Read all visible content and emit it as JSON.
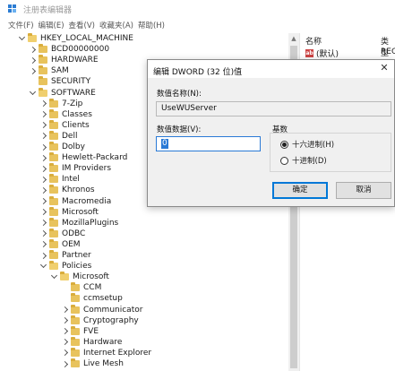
{
  "window": {
    "title": "注册表编辑器"
  },
  "menu": [
    "文件(F)",
    "编辑(E)",
    "查看(V)",
    "收藏夹(A)",
    "帮助(H)"
  ],
  "tree": [
    {
      "label": "HKEY_LOCAL_MACHINE",
      "expanded": true
    },
    {
      "label": "BCD00000000",
      "expanded": false
    },
    {
      "label": "HARDWARE",
      "expanded": false
    },
    {
      "label": "SAM",
      "expanded": false
    },
    {
      "label": "SECURITY",
      "expanded": null
    },
    {
      "label": "SOFTWARE",
      "expanded": true
    },
    {
      "label": "7-Zip",
      "expanded": false
    },
    {
      "label": "Classes",
      "expanded": false
    },
    {
      "label": "Clients",
      "expanded": false
    },
    {
      "label": "Dell",
      "expanded": false
    },
    {
      "label": "Dolby",
      "expanded": false
    },
    {
      "label": "Hewlett-Packard",
      "expanded": false
    },
    {
      "label": "IM Providers",
      "expanded": false
    },
    {
      "label": "Intel",
      "expanded": false
    },
    {
      "label": "Khronos",
      "expanded": false
    },
    {
      "label": "Macromedia",
      "expanded": false
    },
    {
      "label": "Microsoft",
      "expanded": false
    },
    {
      "label": "MozillaPlugins",
      "expanded": false
    },
    {
      "label": "ODBC",
      "expanded": false
    },
    {
      "label": "OEM",
      "expanded": false
    },
    {
      "label": "Partner",
      "expanded": false
    },
    {
      "label": "Policies",
      "expanded": true
    },
    {
      "label": "Microsoft",
      "expanded": true
    },
    {
      "label": "CCM",
      "expanded": null
    },
    {
      "label": "ccmsetup",
      "expanded": null
    },
    {
      "label": "Communicator",
      "expanded": false
    },
    {
      "label": "Cryptography",
      "expanded": false
    },
    {
      "label": "FVE",
      "expanded": false
    },
    {
      "label": "Hardware",
      "expanded": false
    },
    {
      "label": "Internet Explorer",
      "expanded": false
    },
    {
      "label": "Live Mesh",
      "expanded": false
    }
  ],
  "list": {
    "col_name": "名称",
    "col_type": "类型",
    "rows": [
      {
        "name": "(默认)",
        "type": "REG"
      }
    ]
  },
  "dialog": {
    "title": "编辑 DWORD (32 位)值",
    "close": "✕",
    "value_name_label": "数值名称(N):",
    "value_name": "UseWUServer",
    "value_data_label": "数值数据(V):",
    "value_data": "0",
    "base_label": "基数",
    "radio_hex": "十六进制(H)",
    "radio_dec": "十进制(D)",
    "base_selected": "hex",
    "ok": "确定",
    "cancel": "取消"
  }
}
